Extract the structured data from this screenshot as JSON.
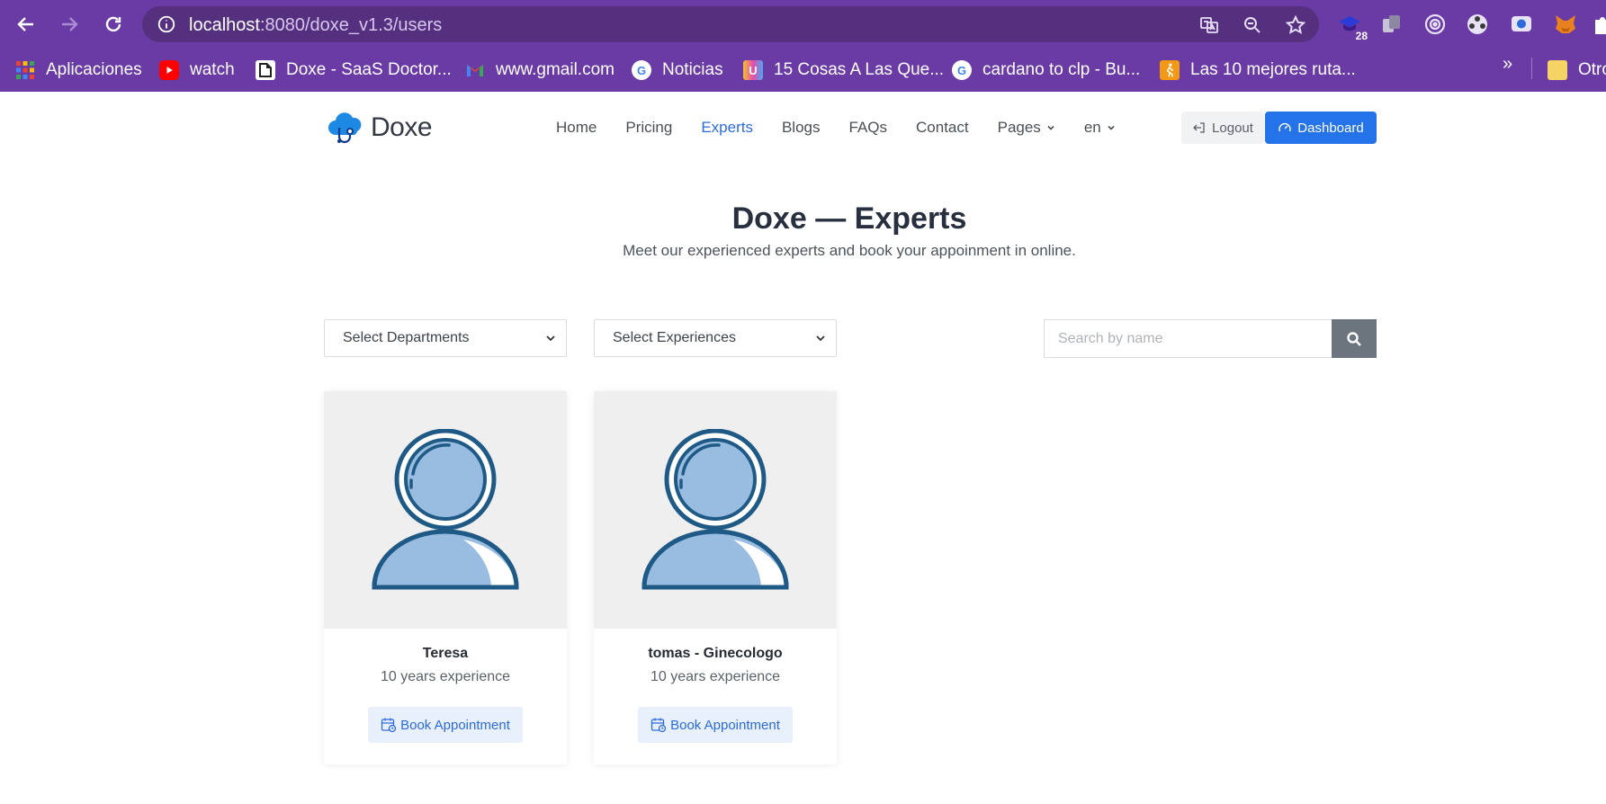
{
  "browser": {
    "url_host": "localhost",
    "url_rest": ":8080/doxe_v1.3/users",
    "extension_badge": "28",
    "bookmarks": [
      {
        "label": "Aplicaciones"
      },
      {
        "label": "watch"
      },
      {
        "label": "Doxe - SaaS Doctor..."
      },
      {
        "label": "www.gmail.com"
      },
      {
        "label": "Noticias"
      },
      {
        "label": "15 Cosas A Las Que..."
      },
      {
        "label": "cardano to clp - Bu..."
      },
      {
        "label": "Las 10 mejores ruta..."
      },
      {
        "label": "Otro"
      }
    ],
    "more": "»"
  },
  "site": {
    "logo_text": "Doxe",
    "nav": [
      {
        "label": "Home"
      },
      {
        "label": "Pricing"
      },
      {
        "label": "Experts"
      },
      {
        "label": "Blogs"
      },
      {
        "label": "FAQs"
      },
      {
        "label": "Contact"
      },
      {
        "label": "Pages"
      },
      {
        "label": "en"
      }
    ],
    "logout_label": "Logout",
    "dashboard_label": "Dashboard",
    "accent": "#2573e8"
  },
  "page": {
    "title": "Doxe — Experts",
    "subtitle": "Meet our experienced experts and book your appoinment in online."
  },
  "filters": {
    "departments": "Select Departments",
    "experiences": "Select Experiences",
    "search_placeholder": "Search by name"
  },
  "experts": [
    {
      "name": "Teresa",
      "experience": "10 years experience",
      "button": "Book Appointment"
    },
    {
      "name": "tomas - Ginecologo",
      "experience": "10 years experience",
      "button": "Book Appointment"
    }
  ]
}
